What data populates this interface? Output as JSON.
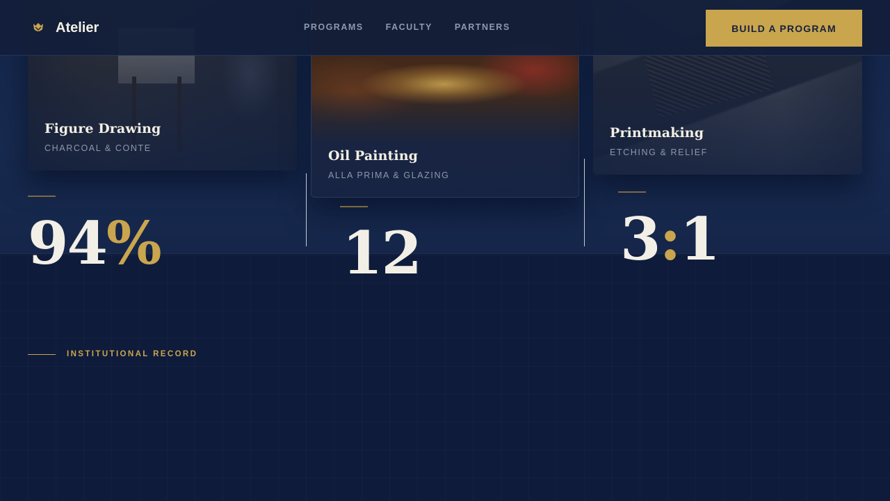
{
  "nav": {
    "brand": "Atelier",
    "links": [
      "PROGRAMS",
      "FACULTY",
      "PARTNERS"
    ],
    "cta": "BUILD A PROGRAM"
  },
  "cards": [
    {
      "title": "Figure Drawing",
      "subtitle": "CHARCOAL & CONTE"
    },
    {
      "title": "Oil Painting",
      "subtitle": "ALLA PRIMA & GLAZING"
    },
    {
      "title": "Printmaking",
      "subtitle": "ETCHING & RELIEF"
    }
  ],
  "record": {
    "eyebrow": "INSTITUTIONAL RECORD",
    "stats": [
      {
        "number": "94",
        "accent": "%"
      },
      {
        "number": "12",
        "accent": ""
      },
      {
        "number": "3",
        "accent": ":",
        "number_after": "1"
      }
    ]
  },
  "colors": {
    "background": "#101c3a",
    "accent_gold": "#c9a54e",
    "text_light": "#f2efe6",
    "text_muted": "#8f98ad"
  }
}
